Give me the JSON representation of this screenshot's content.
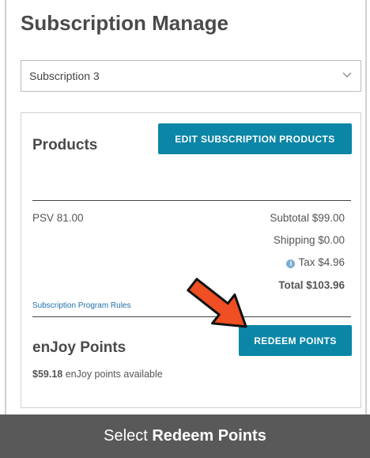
{
  "page": {
    "title": "Subscription Manage"
  },
  "subscription_select": {
    "value": "Subscription 3",
    "icon": "chevron-down-icon"
  },
  "products": {
    "heading": "Products",
    "edit_button": "EDIT SUBSCRIPTION PRODUCTS"
  },
  "summary": {
    "psv": "PSV 81.00",
    "subtotal": "Subtotal $99.00",
    "shipping": "Shipping $0.00",
    "tax": "Tax $4.96",
    "total": "Total $103.96",
    "rules_link": "Subscription Program Rules"
  },
  "points": {
    "heading": "enJoy Points",
    "redeem_button": "REDEEM POINTS",
    "amount": "$59.18",
    "label": "enJoy points available"
  },
  "instruction": {
    "prefix": "Select ",
    "emphasis": "Redeem Points"
  },
  "colors": {
    "accent": "#0b86a6",
    "arrow": "#f04e23",
    "bar": "#595959"
  }
}
